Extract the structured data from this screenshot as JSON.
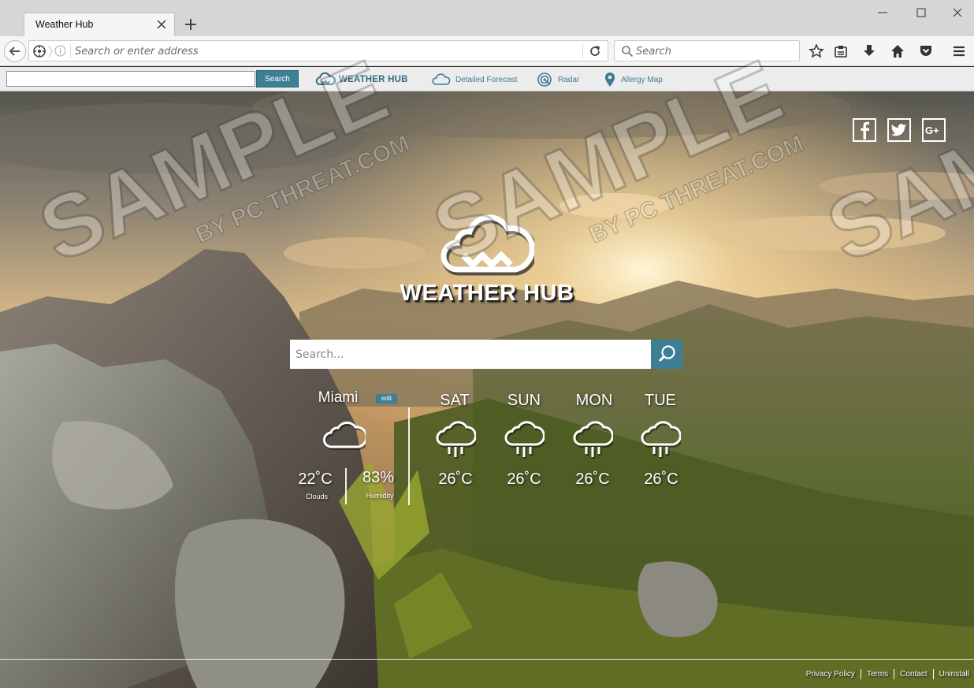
{
  "browser": {
    "tab_title": "Weather Hub",
    "url_placeholder": "Search or enter address",
    "search_placeholder": "Search"
  },
  "toolbar": {
    "search_button": "Search",
    "brand": "WEATHER HUB",
    "links": [
      "Detailed Forecast",
      "Radar",
      "Allergy Map"
    ]
  },
  "page": {
    "logo_text": "WEATHER HUB",
    "search_placeholder": "Search...",
    "current": {
      "city": "Miami",
      "edit_label": "edit",
      "temperature": "22˚C",
      "condition": "Clouds",
      "humidity": "83%",
      "humidity_label": "Humidity"
    },
    "forecast": [
      {
        "day": "SAT",
        "temp": "26˚C",
        "icon": "rain-cloud-icon"
      },
      {
        "day": "SUN",
        "temp": "26˚C",
        "icon": "rain-cloud-icon"
      },
      {
        "day": "MON",
        "temp": "26˚C",
        "icon": "rain-cloud-icon"
      },
      {
        "day": "TUE",
        "temp": "26˚C",
        "icon": "rain-cloud-icon"
      }
    ]
  },
  "footer": {
    "links": [
      "Privacy Policy",
      "Terms",
      "Contact",
      "Uninstall"
    ]
  },
  "watermark": {
    "main": "SAMPLE",
    "sub": "BY PC THREAT.COM"
  },
  "colors": {
    "accent": "#3d7f94",
    "toolbar_link": "#3a7d92"
  }
}
